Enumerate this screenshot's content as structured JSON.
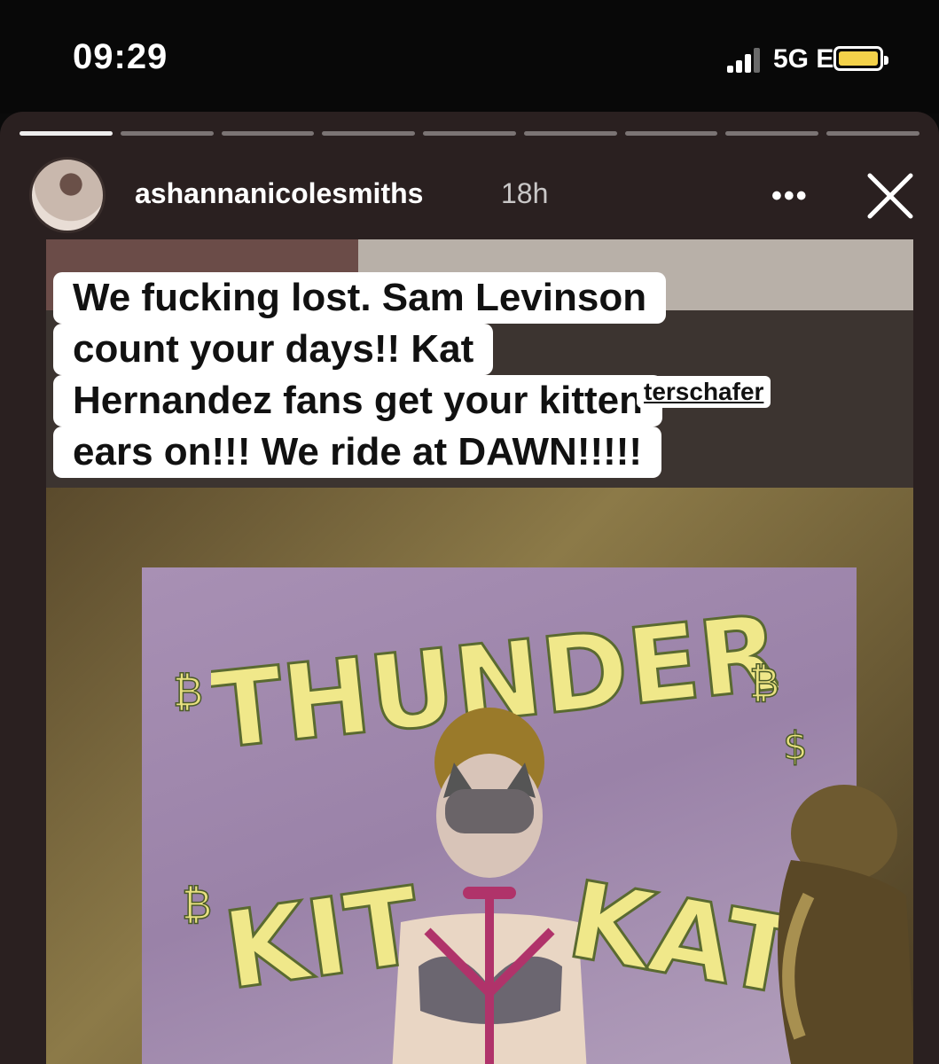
{
  "status_bar": {
    "time": "09:29",
    "network": "5G E",
    "battery_level": 0.9
  },
  "story": {
    "progress_segments": 9,
    "progress_done": 1,
    "username": "ashannanicolesmiths",
    "age": "18h",
    "more_label": "•••",
    "caption_lines": [
      "We fucking lost. Sam Levinson",
      "count your days!! Kat",
      "Hernandez fans get your kitten",
      "ears on!!! We ride at DAWN!!!!!"
    ],
    "mention": "terschafer",
    "artwork": {
      "title_top": "THUNDER",
      "title_bottom_left": "KIT",
      "title_bottom_right": "KAT",
      "symbols": [
        "₿",
        "$"
      ]
    },
    "colors": {
      "background": "#2a2020",
      "battery": "#f4d24a",
      "caption_bg": "#ffffff",
      "lettering": "#f0e88a"
    }
  }
}
